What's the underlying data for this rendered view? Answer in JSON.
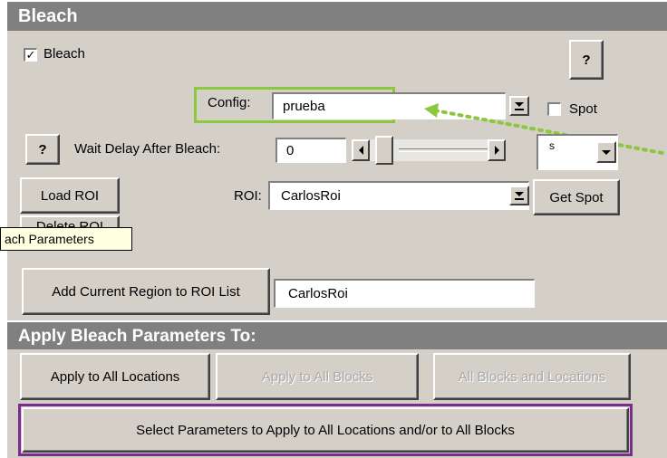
{
  "header": {
    "title": "Bleach"
  },
  "bleach_checkbox": {
    "label": "Bleach",
    "checked": "✓"
  },
  "help_button": {
    "label": "?"
  },
  "help_button_left": {
    "label": "?"
  },
  "config": {
    "label": "Config:",
    "value": "prueba"
  },
  "spot": {
    "label": "Spot"
  },
  "wait_delay": {
    "label": "Wait Delay After Bleach:",
    "value": "0",
    "unit": "s"
  },
  "load_roi": {
    "label": "Load ROI"
  },
  "delete_roi": {
    "label": "Delete ROI"
  },
  "roi": {
    "label": "ROI:",
    "value": "CarlosRoi"
  },
  "get_spot": {
    "label": "Get Spot"
  },
  "tooltip": {
    "text": "ach Parameters"
  },
  "add_region": {
    "label": "Add Current Region to ROI List",
    "value": "CarlosRoi"
  },
  "apply_header": {
    "title": "Apply Bleach Parameters To:"
  },
  "apply_buttons": {
    "all_locations": "Apply to All Locations",
    "all_blocks": "Apply to All Blocks",
    "blocks_and_locations": "All Blocks and Locations"
  },
  "select_params": {
    "label": "Select Parameters to Apply to All Locations and/or to All Blocks"
  },
  "colors": {
    "highlight_green": "#8dc63f",
    "highlight_purple": "#7b2d8e",
    "arrow_green": "#8dc63f"
  }
}
